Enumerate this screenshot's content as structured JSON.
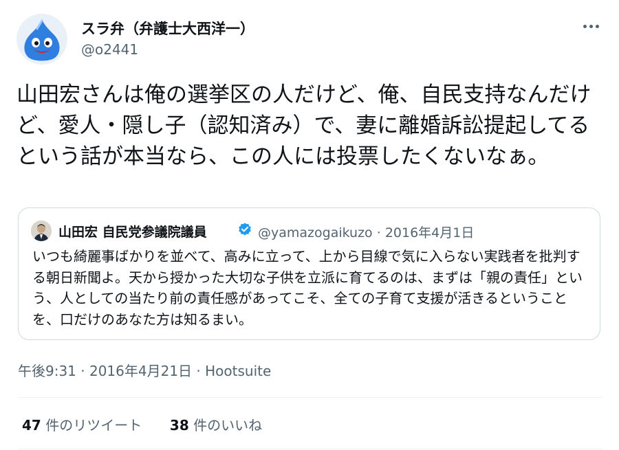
{
  "author": {
    "display_name": "スラ弁（弁護士大西洋一）",
    "handle": "@o2441",
    "avatar_icon": "slime-mascot-icon"
  },
  "tweet": {
    "text": "山田宏さんは俺の選挙区の人だけど、俺、自民支持なんだけど、愛人・隠し子（認知済み）で、妻に離婚訴訟提起してるという話が本当なら、この人には投票したくないなぁ。"
  },
  "quoted": {
    "display_name": "山田宏 自民党参議院議員",
    "handle": "@yamazogaikuzo",
    "separator": "·",
    "date": "2016年4月1日",
    "text": "いつも綺麗事ばかりを並べて、高みに立って、上から目線で気に入らない実践者を批判する朝日新聞よ。天から授かった大切な子供を立派に育てるのは、まずは「親の責任」という、人としての当たり前の責任感があってこそ、全ての子育て支援が活きるということを、口だけのあなた方は知るまい。",
    "verified_color": "#1d9bf0"
  },
  "meta": {
    "timestamp": "午後9:31 · 2016年4月21日 · Hootsuite"
  },
  "stats": {
    "retweets_count": "47",
    "retweets_label": " 件のリツイート",
    "likes_count": "38",
    "likes_label": " 件のいいね"
  },
  "colors": {
    "text": "#0f1419",
    "secondary": "#536471",
    "border": "#cfd9de",
    "accent": "#1d9bf0"
  }
}
